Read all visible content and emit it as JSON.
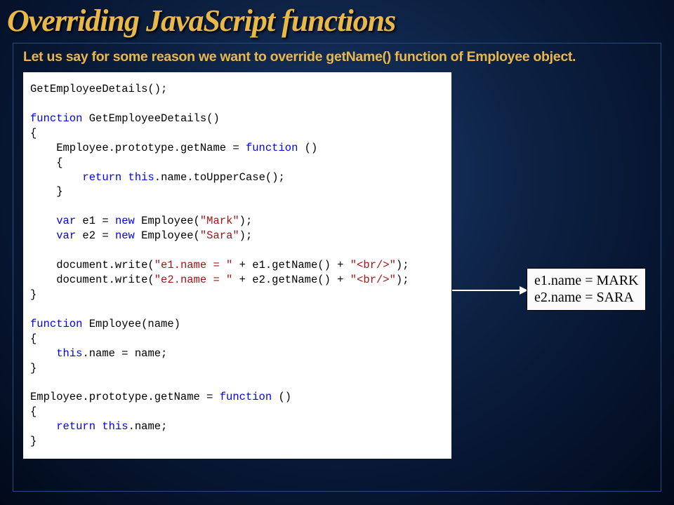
{
  "title": "Overriding JavaScript functions",
  "subtitle": "Let us say for some reason we want to override getName() function of Employee object.",
  "code": {
    "l1a": "GetEmployeeDetails();",
    "l2a": "function",
    "l2b": " GetEmployeeDetails()",
    "l3a": "{",
    "l4a": "    Employee.prototype.getName = ",
    "l4b": "function",
    "l4c": " ()",
    "l5a": "    {",
    "l6a": "        ",
    "l6b": "return",
    "l6c": " ",
    "l6d": "this",
    "l6e": ".name.toUpperCase();",
    "l7a": "    }",
    "l8a": "    ",
    "l8b": "var",
    "l8c": " e1 = ",
    "l8d": "new",
    "l8e": " Employee(",
    "l8f": "\"Mark\"",
    "l8g": ");",
    "l9a": "    ",
    "l9b": "var",
    "l9c": " e2 = ",
    "l9d": "new",
    "l9e": " Employee(",
    "l9f": "\"Sara\"",
    "l9g": ");",
    "l10a": "    document.write(",
    "l10b": "\"e1.name = \"",
    "l10c": " + e1.getName() + ",
    "l10d": "\"<br/>\"",
    "l10e": ");",
    "l11a": "    document.write(",
    "l11b": "\"e2.name = \"",
    "l11c": " + e2.getName() + ",
    "l11d": "\"<br/>\"",
    "l11e": ");",
    "l12a": "}",
    "l13a": "function",
    "l13b": " Employee(name)",
    "l14a": "{",
    "l15a": "    ",
    "l15b": "this",
    "l15c": ".name = name;",
    "l16a": "}",
    "l17a": "Employee.prototype.getName = ",
    "l17b": "function",
    "l17c": " ()",
    "l18a": "{",
    "l19a": "    ",
    "l19b": "return",
    "l19c": " ",
    "l19d": "this",
    "l19e": ".name;",
    "l20a": "}"
  },
  "output": {
    "line1": "e1.name = MARK",
    "line2": "e2.name = SARA"
  }
}
